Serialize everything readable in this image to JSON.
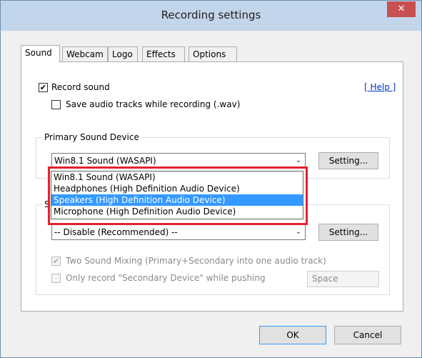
{
  "window": {
    "title": "Recording settings",
    "close_glyph": "✕"
  },
  "tabs": [
    {
      "label": "Sound",
      "active": true
    },
    {
      "label": "Webcam",
      "active": false
    },
    {
      "label": "Logo",
      "active": false
    },
    {
      "label": "Effects",
      "active": false
    },
    {
      "label": "Options",
      "active": false
    }
  ],
  "sound": {
    "record_sound": {
      "label": "Record sound",
      "checked": true
    },
    "save_tracks": {
      "label": "Save audio tracks while recording (.wav)",
      "checked": false
    },
    "help_link": "[ Help ]",
    "primary": {
      "group_title": "Primary Sound Device",
      "selected": "Win8.1 Sound (WASAPI)",
      "setting_label": "Setting..."
    },
    "dropdown_options": [
      {
        "label": "Win8.1 Sound (WASAPI)",
        "highlighted": false
      },
      {
        "label": "Headphones (High Definition Audio Device)",
        "highlighted": false
      },
      {
        "label": "Speakers (High Definition Audio Device)",
        "highlighted": true
      },
      {
        "label": "Microphone (High Definition Audio Device)",
        "highlighted": false
      }
    ],
    "secondary": {
      "group_title_visible": "S",
      "selected": "-- Disable (Recommended) --",
      "setting_label": "Setting..."
    },
    "two_sound_mixing": {
      "label": "Two Sound Mixing (Primary+Secondary into one audio track)",
      "checked": true,
      "enabled": false
    },
    "only_record_secondary": {
      "label": "Only record \"Secondary Device\" while pushing",
      "checked": false,
      "enabled": false
    },
    "hotkey_value": "Space"
  },
  "footer": {
    "ok_label": "OK",
    "cancel_label": "Cancel"
  },
  "colors": {
    "titlebar": "#c3d5ea",
    "close_button": "#c75050",
    "selection": "#3399ff",
    "annotation_box": "#e5202e",
    "link": "#0033cc"
  },
  "check_glyph": "✔",
  "arrow_glyph": "⌄"
}
